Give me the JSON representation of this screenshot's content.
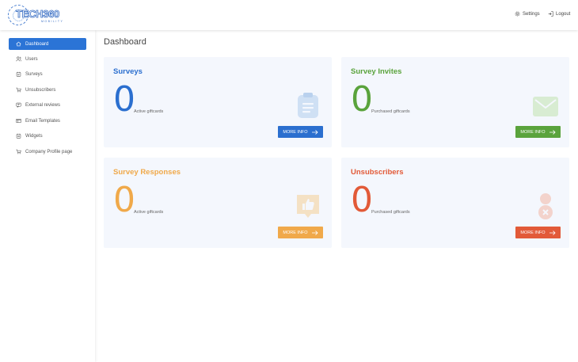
{
  "header": {
    "logo_text": "TECH360",
    "logo_sub": "MOBILITY",
    "settings_label": "Settings",
    "logout_label": "Logout"
  },
  "sidebar": {
    "items": [
      {
        "label": "Dashboard",
        "icon": "home-icon",
        "active": true
      },
      {
        "label": "Users",
        "icon": "users-icon"
      },
      {
        "label": "Surveys",
        "icon": "survey-icon"
      },
      {
        "label": "Unsubscribers",
        "icon": "cart-icon"
      },
      {
        "label": "External reviews",
        "icon": "review-icon"
      },
      {
        "label": "Email Templates",
        "icon": "template-icon"
      },
      {
        "label": "Widgets",
        "icon": "widget-icon"
      },
      {
        "label": "Company Profile page",
        "icon": "cart-icon"
      }
    ]
  },
  "main": {
    "title": "Dashboard",
    "cards": [
      {
        "title": "Surveys",
        "value": "0",
        "label": "Active giftcards",
        "button": "MORE INFO",
        "icon": "clipboard-icon",
        "color": "#2b6fcf",
        "icon_color": "#cfe0f4"
      },
      {
        "title": "Survey Invites",
        "value": "0",
        "label": "Purchased giftcards",
        "button": "MORE INFO",
        "icon": "envelope-icon",
        "color": "#5aa33c",
        "icon_color": "#d8ecd2"
      },
      {
        "title": "Survey Responses",
        "value": "0",
        "label": "Active giftcards",
        "button": "MORE INFO",
        "icon": "thumbs-up-icon",
        "color": "#f0a94a",
        "icon_color": "#f4e1c4"
      },
      {
        "title": "Unsubscribers",
        "value": "0",
        "label": "Purchased giftcards",
        "button": "MORE INFO",
        "icon": "user-remove-icon",
        "color": "#e25a38",
        "icon_color": "#f3d3cc"
      }
    ]
  }
}
